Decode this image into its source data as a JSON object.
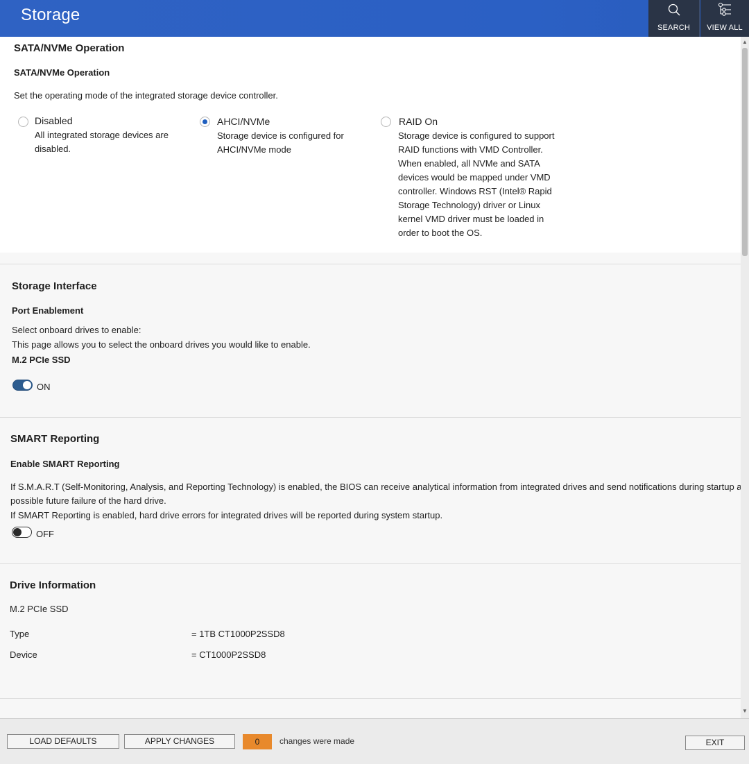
{
  "header": {
    "title": "Storage",
    "search_label": "SEARCH",
    "view_all_label": "VIEW ALL"
  },
  "sata": {
    "section_title": "SATA/NVMe Operation",
    "setting_title": "SATA/NVMe Operation",
    "description": "Set the operating mode of the integrated storage device controller.",
    "selected": "AHCI/NVMe",
    "options": [
      {
        "label": "Disabled",
        "lines": [
          "All integrated storage devices are",
          "disabled."
        ]
      },
      {
        "label": "AHCI/NVMe",
        "lines": [
          "Storage device is configured for",
          "AHCI/NVMe mode"
        ]
      },
      {
        "label": "RAID On",
        "lines": [
          "Storage device is configured to support",
          "RAID functions with VMD Controller.",
          "When enabled, all NVMe and SATA",
          "devices would be mapped under VMD",
          "controller. Windows RST (Intel® Rapid",
          "Storage Technology) driver or Linux",
          "kernel VMD driver must be loaded in",
          "order to boot the OS."
        ]
      }
    ]
  },
  "storage_interface": {
    "section_title": "Storage Interface",
    "setting_title": "Port Enablement",
    "line1": "Select onboard drives to enable:",
    "line2": "This page allows you to select the onboard drives you would like to enable.",
    "device_label": "M.2 PCIe SSD",
    "toggle_state": "ON"
  },
  "smart": {
    "section_title": "SMART Reporting",
    "setting_title": "Enable SMART Reporting",
    "line1": "If S.M.A.R.T (Self-Monitoring, Analysis, and Reporting Technology) is enabled, the BIOS can receive analytical information from integrated drives and send notifications during startup about",
    "line2": "possible future failure of the hard drive.",
    "line3": "If SMART Reporting is enabled, hard drive errors for integrated drives will be reported during system startup.",
    "toggle_state": "OFF"
  },
  "drive_info": {
    "section_title": "Drive Information",
    "device_heading": "M.2 PCIe SSD",
    "rows": [
      {
        "label": "Type",
        "value": "= 1TB CT1000P2SSD8"
      },
      {
        "label": "Device",
        "value": "= CT1000P2SSD8"
      }
    ]
  },
  "footer": {
    "load_defaults": "LOAD DEFAULTS",
    "apply_changes": "APPLY CHANGES",
    "changes_count": "0",
    "changes_label": "changes were made",
    "exit": "EXIT"
  },
  "colors": {
    "header_blue": "#2b60c4",
    "header_tool_bg": "#2a3446",
    "toggle_on": "#2d5d90",
    "radio_selected": "#1f5fbf",
    "changes_badge": "#e8892c"
  },
  "icons": {
    "search": "search-icon",
    "view_all": "view-all-icon"
  }
}
